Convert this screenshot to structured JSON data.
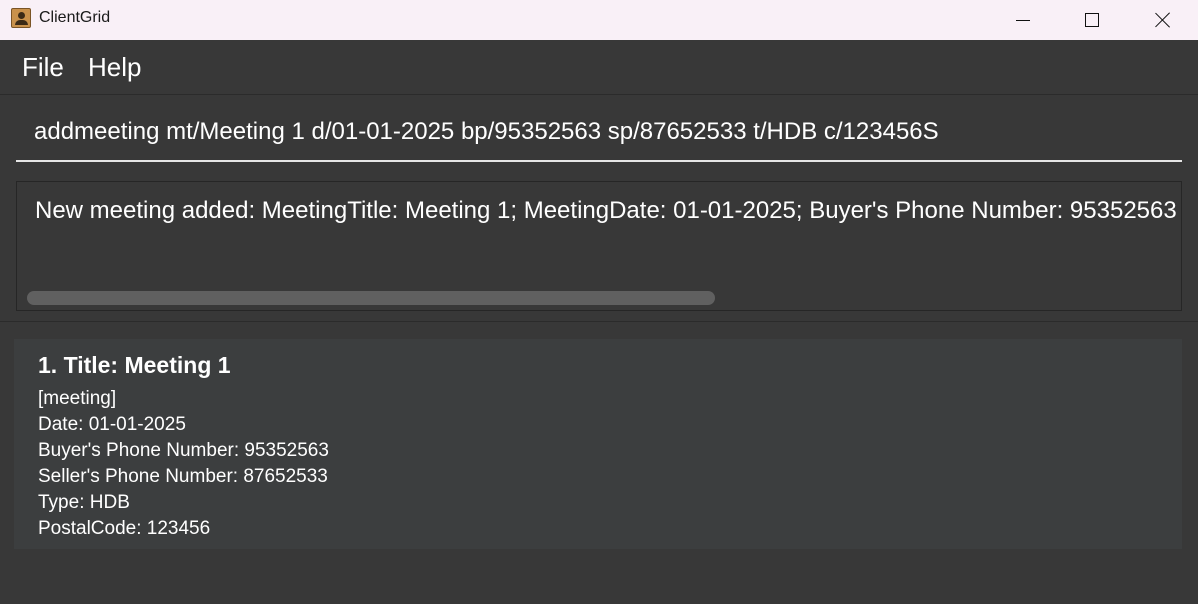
{
  "window": {
    "title": "ClientGrid"
  },
  "menu": {
    "items": [
      {
        "label": "File"
      },
      {
        "label": "Help"
      }
    ]
  },
  "command": {
    "value": "addmeeting mt/Meeting 1 d/01-01-2025 bp/95352563 sp/87652533 t/HDB c/123456S"
  },
  "result": {
    "text": "New meeting added: MeetingTitle: Meeting 1; MeetingDate: 01-01-2025; Buyer's Phone Number: 95352563"
  },
  "meeting_list": [
    {
      "title": "1. Title: Meeting 1",
      "tag": "[meeting]",
      "date": "Date: 01-01-2025",
      "buyer_phone": "Buyer's Phone Number: 95352563",
      "seller_phone": "Seller's Phone Number: 87652533",
      "type": "Type: HDB",
      "postal_code": "PostalCode: 123456"
    }
  ],
  "colors": {
    "background": "#383838",
    "titlebar": "#f9f0f7",
    "card": "#3c3e3f",
    "text": "#ffffff"
  }
}
